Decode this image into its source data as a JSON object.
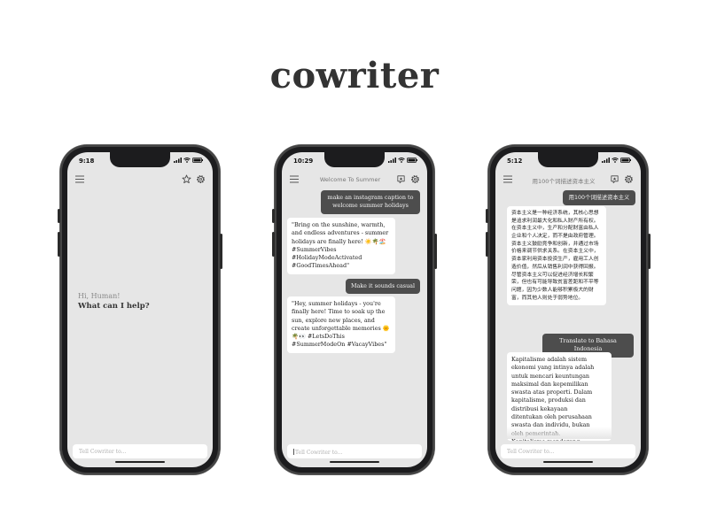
{
  "brand": {
    "name": "cowriter"
  },
  "phones": [
    {
      "time": "9:18",
      "greeting": {
        "hi": "Hi, Human!",
        "question": "What can I help?"
      },
      "input_placeholder": "Tell Cowriter to..."
    },
    {
      "time": "10:29",
      "title": "Welcome To Summer",
      "messages": [
        {
          "role": "user",
          "text": "make an instagram caption to welcome summer holidays"
        },
        {
          "role": "bot",
          "text": "\"Bring on the sunshine, warmth, and endless adventures - summer holidays are finally here! ☀️🌴🏖️ #SummerVibes #HolidayModeActivated #GoodTimesAhead\""
        },
        {
          "role": "user",
          "text": "Make it sounds casual"
        },
        {
          "role": "bot",
          "text": "\"Hey, summer holidays - you're finally here! Time to soak up the sun, explore new places, and create unforgettable memories 🌞🌴👀 #LetsDoThis #SummerModeOn #VacayVibes\""
        }
      ],
      "input_placeholder": "Tell Cowriter to..."
    },
    {
      "time": "5:12",
      "title": "用100个词描述资本主义",
      "messages": [
        {
          "role": "user",
          "text": "用100个词描述资本主义"
        },
        {
          "role": "bot",
          "text": "资本主义是一种经济系统，其核心思想是追求利润最大化和私人财产所有权。在资本主义中，生产和分配财富由私人企业和个人决定，而不是由政府管理。资本主义鼓励竞争和创新，并通过市场价格来调节供求关系。在资本主义中，资本家利用资本投资生产，雇用工人创造价值，然后从销售利润中获得回报。尽管资本主义可以促进经济增长和繁荣，但也有可能导致贫富差距和不平等问题，因为少数人能够积累极大的财富，而其他人则处于弱势地位。"
        },
        {
          "role": "user",
          "text": "Translate to Bahasa Indonesia"
        },
        {
          "role": "bot",
          "text": "Kapitalisme adalah sistem ekonomi yang intinya adalah untuk mencari keuntungan maksimal dan kepemilikan swasta atas properti. Dalam kapitalisme, produksi dan distribusi kekayaan ditentukan oleh perusahaan swasta dan individu, bukan oleh pemerintah. Kapitalisme mendorong"
        }
      ],
      "input_placeholder": "Tell Cowriter to..."
    }
  ]
}
